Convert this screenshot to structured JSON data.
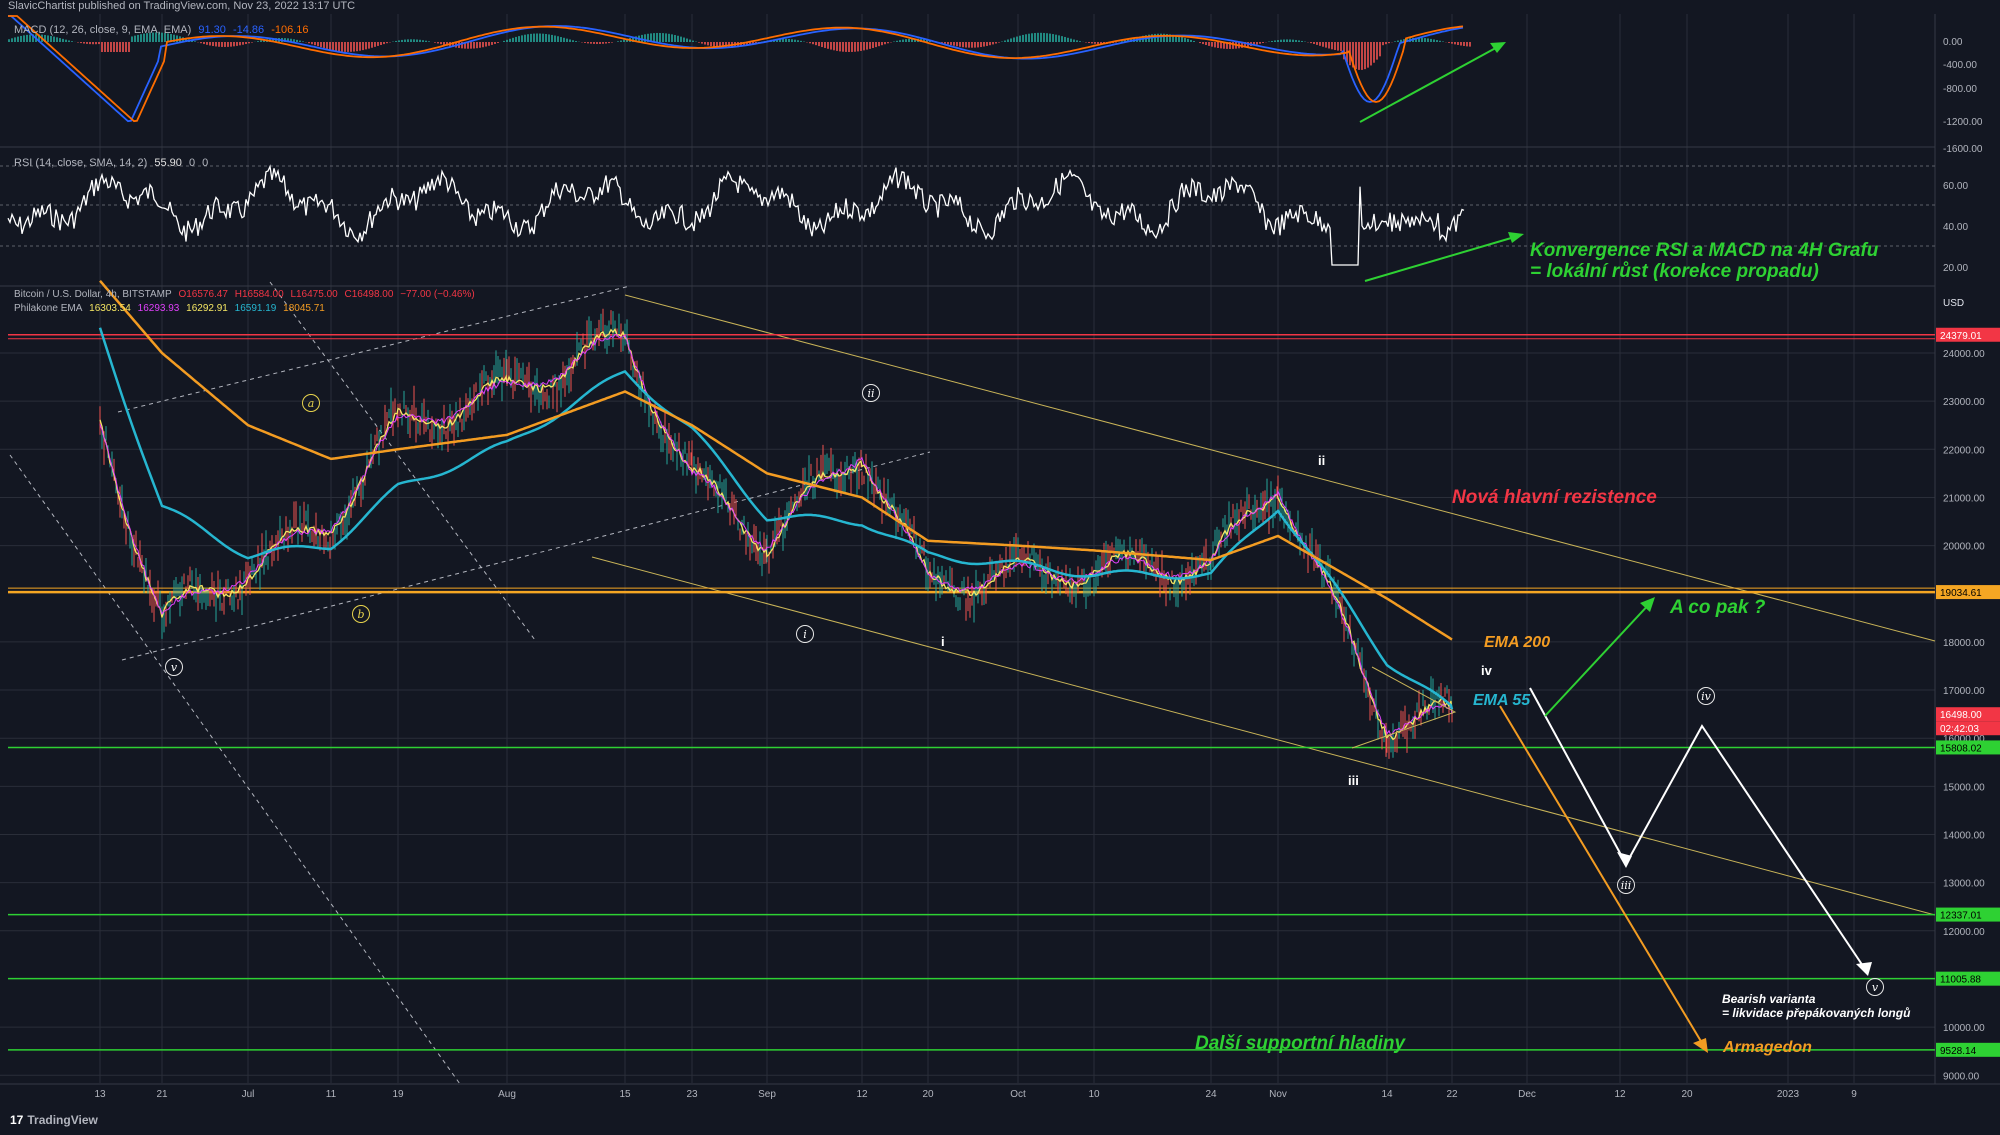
{
  "header": {
    "publisher": "SlavicChartist published on TradingView.com, Nov 23, 2022 13:17 UTC"
  },
  "macd_legend": {
    "name": "MACD (12, 26, close, 9, EMA, EMA)",
    "v1": "91.30",
    "v2": "-14.86",
    "v3": "-106.16"
  },
  "rsi_legend": {
    "name": "RSI (14, close, SMA, 14, 2)",
    "v1": "55.90",
    "v2": "0",
    "v3": "0"
  },
  "price_legend": {
    "symbol": "Bitcoin / U.S. Dollar, 4h, BITSTAMP",
    "o": "O16576.47",
    "h": "H16584.00",
    "l": "L16475.00",
    "c": "C16498.00",
    "chg": "−77.00 (−0.46%)"
  },
  "ema_legend": {
    "name": "Philakone EMA",
    "v1": "16303.54",
    "v2": "16293.93",
    "v3": "16292.91",
    "v4": "16591.19",
    "v5": "18045.71"
  },
  "macd_axis": [
    "0.00",
    "-400.00",
    "-800.00",
    "-1200.00",
    "-1600.00"
  ],
  "rsi_axis": [
    "60.00",
    "40.00",
    "20.00"
  ],
  "price_axis": {
    "currency": "USD",
    "ticks": [
      "24000.00",
      "23000.00",
      "22000.00",
      "21000.00",
      "20000.00",
      "18000.00",
      "17000.00",
      "16000.00",
      "15000.00",
      "14000.00",
      "13000.00",
      "12000.00",
      "10000.00",
      "9000.00"
    ],
    "top_cut": "25000.00"
  },
  "price_badges": [
    {
      "value": "24379.01",
      "color": "#f23645"
    },
    {
      "value": "19034.61",
      "color": "#f5a623"
    },
    {
      "value": "16498.00",
      "color": "#f23645"
    },
    {
      "value": "02:42:03",
      "color": "#f23645"
    },
    {
      "value": "15808.02",
      "color": "#2ed133"
    },
    {
      "value": "12337.01",
      "color": "#2ed133"
    },
    {
      "value": "11005.88",
      "color": "#2ed133"
    },
    {
      "value": "9528.14",
      "color": "#2ed133"
    }
  ],
  "time_axis": [
    "13",
    "21",
    "Jul",
    "11",
    "19",
    "Aug",
    "15",
    "23",
    "Sep",
    "12",
    "20",
    "Oct",
    "10",
    "24",
    "Nov",
    "14",
    "22",
    "Dec",
    "12",
    "20",
    "2023",
    "9"
  ],
  "annotations": {
    "rsi_macd_line1": "Konvergence RSI a MACD na 4H Grafu",
    "rsi_macd_line2": "= lokální růst (korekce propadu)",
    "resistance": "Nová hlavní rezistence",
    "question": "A co pak ?",
    "ema200": "EMA 200",
    "ema55": "EMA 55",
    "bearish1": "Bearish varianta",
    "bearish2": "= likvidace přepákovaných longů",
    "support": "Další supportní hladiny",
    "armageddon": "Armagedon"
  },
  "wave_labels": {
    "v_circ_left": "v",
    "a": "a",
    "b": "b",
    "ii_circ": "ii",
    "i_circ": "i",
    "i_small": "i",
    "ii_top": "ii",
    "iii_low": "iii",
    "iv_small": "iv",
    "iii_circ": "iii",
    "iv_circ": "iv",
    "v_circ": "v"
  },
  "footer": {
    "brand": "TradingView"
  },
  "colors": {
    "bg": "#131722",
    "grid": "#2a2e39",
    "ema_fast": "#f5e663",
    "ema55": "#26b6d0",
    "ema200": "#f39c22",
    "green": "#2ed133",
    "red": "#f23645"
  },
  "chart_data": {
    "type": "line",
    "title": "Bitcoin / U.S. Dollar, 4h, BITSTAMP",
    "x": [
      "13",
      "21",
      "Jul",
      "11",
      "19",
      "Aug",
      "15",
      "23",
      "Sep",
      "12",
      "20",
      "Oct",
      "10",
      "24",
      "Nov",
      "14",
      "22"
    ],
    "series": [
      {
        "name": "Bitcoin / U.S. Dollar",
        "values": [
          22500,
          18500,
          19500,
          20500,
          22500,
          23200,
          24300,
          21400,
          20100,
          22000,
          19200,
          19400,
          19500,
          19600,
          21300,
          16300,
          16500
        ]
      },
      {
        "name": "EMA 55",
        "values": [
          24500,
          20800,
          19800,
          20000,
          21200,
          22100,
          23600,
          22400,
          20600,
          20500,
          19800,
          19600,
          19400,
          19400,
          20800,
          17600,
          16600
        ]
      },
      {
        "name": "EMA 200",
        "values": [
          25500,
          24000,
          22500,
          21800,
          22000,
          22300,
          23200,
          22500,
          21500,
          21000,
          20100,
          20000,
          19900,
          19700,
          20200,
          18900,
          18050
        ]
      }
    ],
    "levels": [
      24379.01,
      19034.61,
      15808.02,
      12337.01,
      11005.88,
      9528.14
    ],
    "ylim": [
      9000,
      25000
    ],
    "indicators": {
      "rsi_last": 55.9,
      "macd": 91.3
    }
  }
}
